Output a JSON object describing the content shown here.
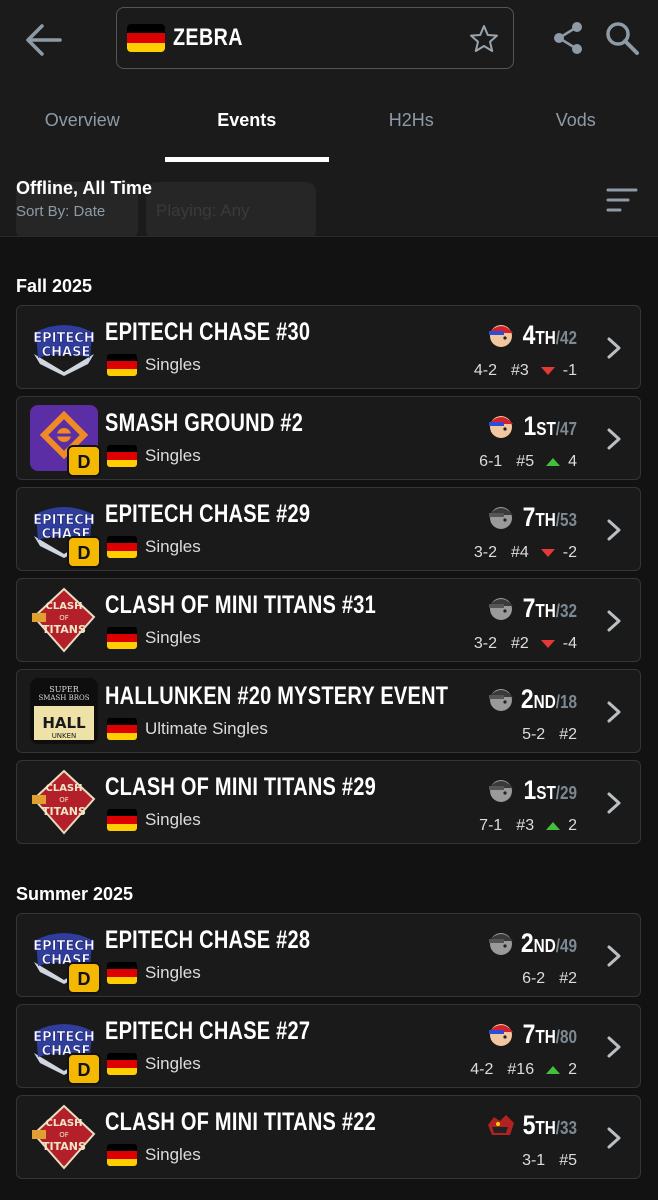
{
  "header": {
    "player_name": "ZEBRA",
    "tabs": [
      {
        "label": "Overview"
      },
      {
        "label": "Events"
      },
      {
        "label": "H2Hs"
      },
      {
        "label": "Vods"
      }
    ],
    "active_tab": "Events"
  },
  "filter": {
    "title": "Offline, All Time",
    "sort": "Sort By: Date",
    "ghost_chip": "Playing: Any"
  },
  "sections": [
    {
      "title": "Fall 2025",
      "events": [
        {
          "name": "EPITECH CHASE #30",
          "type": "Singles",
          "logo": "epitech-chase-logo",
          "dq": false,
          "character": "ness-icon",
          "place": "4",
          "suffix": "TH",
          "entrants": "/42",
          "record": "4-2",
          "seed": "#3",
          "trend": "down",
          "delta": "-1"
        },
        {
          "name": "SMASH GROUND #2",
          "type": "Singles",
          "logo": "smash-ground-logo",
          "dq": true,
          "character": "ness-icon",
          "place": "1",
          "suffix": "ST",
          "entrants": "/47",
          "record": "6-1",
          "seed": "#5",
          "trend": "up",
          "delta": "4"
        },
        {
          "name": "EPITECH CHASE #29",
          "type": "Singles",
          "logo": "epitech-chase-logo",
          "dq": true,
          "character": "ness-grey-icon",
          "place": "7",
          "suffix": "TH",
          "entrants": "/53",
          "record": "3-2",
          "seed": "#4",
          "trend": "down",
          "delta": "-2"
        },
        {
          "name": "CLASH OF MINI TITANS #31",
          "type": "Singles",
          "logo": "clash-of-titans-logo",
          "dq": false,
          "character": "ness-grey-icon",
          "place": "7",
          "suffix": "TH",
          "entrants": "/32",
          "record": "3-2",
          "seed": "#2",
          "trend": "down",
          "delta": "-4"
        },
        {
          "name": "HALLUNKEN #20 MYSTERY EVENT",
          "type": "Ultimate Singles",
          "logo": "hallunken-logo",
          "dq": false,
          "character": "ness-grey-icon",
          "place": "2",
          "suffix": "ND",
          "entrants": "/18",
          "record": "5-2",
          "seed": "#2",
          "trend": "none",
          "delta": ""
        },
        {
          "name": "CLASH OF MINI TITANS #29",
          "type": "Singles",
          "logo": "clash-of-titans-logo",
          "dq": false,
          "character": "ness-grey-icon",
          "place": "1",
          "suffix": "ST",
          "entrants": "/29",
          "record": "7-1",
          "seed": "#3",
          "trend": "up",
          "delta": "2"
        }
      ]
    },
    {
      "title": "Summer 2025",
      "events": [
        {
          "name": "EPITECH CHASE #28",
          "type": "Singles",
          "logo": "epitech-chase-logo",
          "dq": true,
          "character": "ness-grey-icon",
          "place": "2",
          "suffix": "ND",
          "entrants": "/49",
          "record": "6-2",
          "seed": "#2",
          "trend": "none",
          "delta": ""
        },
        {
          "name": "EPITECH CHASE #27",
          "type": "Singles",
          "logo": "epitech-chase-logo",
          "dq": true,
          "character": "ness-icon",
          "place": "7",
          "suffix": "TH",
          "entrants": "/80",
          "record": "4-2",
          "seed": "#16",
          "trend": "up",
          "delta": "2"
        },
        {
          "name": "CLASH OF MINI TITANS #22",
          "type": "Singles",
          "logo": "clash-of-titans-logo",
          "dq": false,
          "character": "incineroar-icon",
          "place": "5",
          "suffix": "TH",
          "entrants": "/33",
          "record": "3-1",
          "seed": "#5",
          "trend": "none",
          "delta": ""
        }
      ]
    }
  ],
  "badge_label": "D",
  "colors": {
    "background": "#121212",
    "card": "#1a1a1a",
    "muted": "#8e9ba6",
    "trend_up": "#43c03a",
    "trend_down": "#e53935",
    "dq_badge": "#f5b800"
  }
}
